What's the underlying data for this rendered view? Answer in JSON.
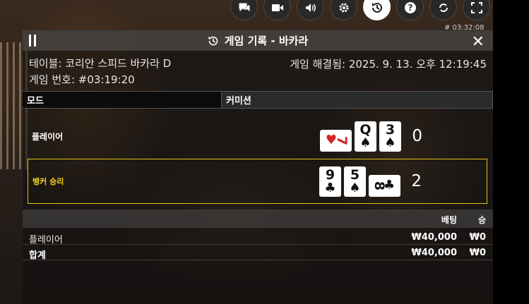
{
  "top_bar": {
    "icons": [
      "chat-icon",
      "video-icon",
      "volume-icon",
      "settings-icon",
      "history-icon",
      "help-icon",
      "switch-icon",
      "fullscreen-icon"
    ],
    "game_id": "# 03:32:08"
  },
  "panel": {
    "title": "게임 기록 - 바카라",
    "table_label": "테이블: 코리안 스피드 바카라 D",
    "game_number_label": "게임 번호: #03:19:20",
    "resolved_label": "게임 해결됨: 2025. 9. 13. 오후 12:19:45",
    "mode_label": "모드",
    "commission_label": "커미션"
  },
  "hands": {
    "player": {
      "label": "플레이어",
      "score": "0",
      "cards": [
        {
          "rank": "7",
          "suit": "♥",
          "color": "#d8222a",
          "sideways": true
        },
        {
          "rank": "Q",
          "suit": "♠",
          "color": "#111111",
          "sideways": false
        },
        {
          "rank": "3",
          "suit": "♠",
          "color": "#111111",
          "sideways": false
        }
      ]
    },
    "banker": {
      "label": "뱅커 승리",
      "score": "2",
      "cards": [
        {
          "rank": "9",
          "suit": "♣",
          "color": "#111111",
          "sideways": false
        },
        {
          "rank": "5",
          "suit": "♠",
          "color": "#111111",
          "sideways": false
        },
        {
          "rank": "8",
          "suit": "♣",
          "color": "#111111",
          "sideways": true
        }
      ]
    }
  },
  "bets": {
    "header_bet": "베팅",
    "header_win": "승",
    "rows": [
      {
        "label": "플레이어",
        "amount": "₩40,000",
        "win": "₩0"
      }
    ],
    "total": {
      "label": "합계",
      "amount": "₩40,000",
      "win": "₩0"
    }
  },
  "colors": {
    "banker_highlight": "#e2c11b",
    "banker_text": "#f3d21f",
    "red_suit": "#d8222a"
  }
}
